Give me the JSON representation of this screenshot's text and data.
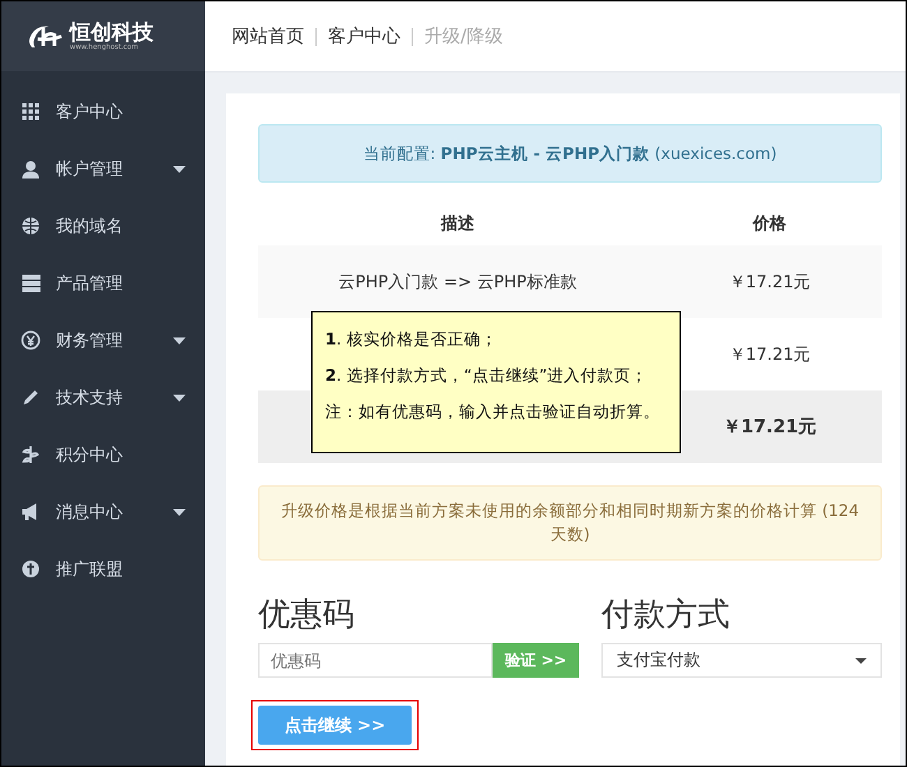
{
  "logo": {
    "name": "恒创科技",
    "url": "www.henghost.com"
  },
  "sidebar": {
    "items": [
      {
        "label": "客户中心",
        "expandable": false
      },
      {
        "label": "帐户管理",
        "expandable": true
      },
      {
        "label": "我的域名",
        "expandable": false
      },
      {
        "label": "产品管理",
        "expandable": false
      },
      {
        "label": "财务管理",
        "expandable": true
      },
      {
        "label": "技术支持",
        "expandable": true
      },
      {
        "label": "积分中心",
        "expandable": false
      },
      {
        "label": "消息中心",
        "expandable": true
      },
      {
        "label": "推广联盟",
        "expandable": false
      }
    ]
  },
  "breadcrumb": [
    {
      "label": "网站首页",
      "current": false
    },
    {
      "label": "客户中心",
      "current": false
    },
    {
      "label": "升级/降级",
      "current": true
    }
  ],
  "config_alert": "当前配置: **PHP云主机 - 云PHP入门款** (xuexices.com)",
  "table": {
    "columns": [
      "描述",
      "价格"
    ],
    "rows": [
      {
        "description": "云PHP入门款 => 云PHP标准款",
        "price": "￥17.21元",
        "total": false
      },
      {
        "price": "￥17.21元",
        "total": false
      },
      {
        "price": "￥17.21元",
        "total": true
      }
    ]
  },
  "tooltip": {
    "lines": [
      "**1**. 核实价格是否正确；",
      "**2**. 选择付款方式，“点击继续”进入付款页；",
      "注：如有优惠码，输入并点击验证自动折算。"
    ]
  },
  "notice": "升级价格是根据当前方案未使用的余额部分和相同时期新方案的价格计算 (124 天数)",
  "coupon": {
    "heading": "优惠码",
    "placeholder": "优惠码",
    "button": "验证 >>"
  },
  "payment": {
    "heading": "付款方式",
    "value": "支付宝付款"
  },
  "continue_button": {
    "label": "点击继续 >>",
    "highlighted": true
  }
}
